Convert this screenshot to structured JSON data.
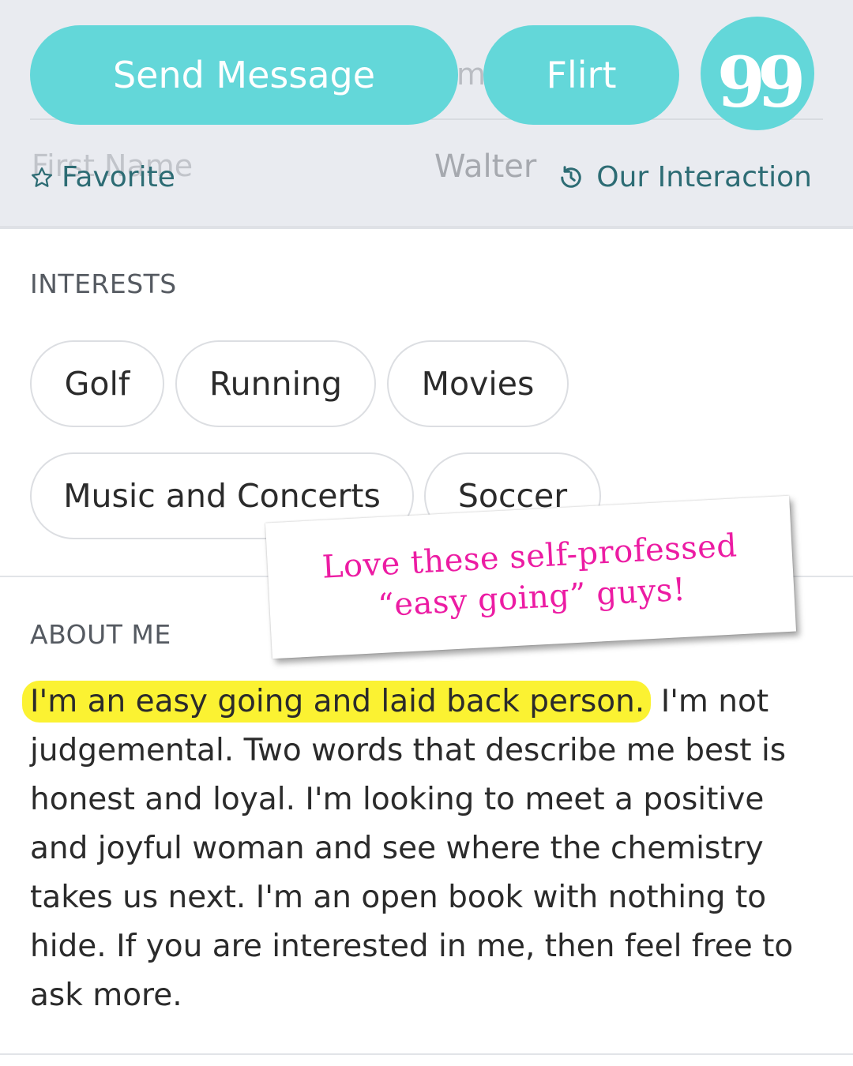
{
  "header": {
    "send_message_label": "Send Message",
    "flirt_label": "Flirt",
    "quote_glyph": "99",
    "ghost_text": "m",
    "first_name_label": "First Name",
    "first_name_value": "Walter",
    "favorite_label": "Favorite",
    "interaction_label": "Our Interaction"
  },
  "interests": {
    "title": "INTERESTS",
    "items": [
      "Golf",
      "Running",
      "Movies",
      "Music and Concerts",
      "Soccer"
    ]
  },
  "about": {
    "title": "ABOUT ME",
    "highlighted": "I'm an easy going and laid back person.",
    "rest": " I'm not judgemental. Two words that describe me best is honest and loyal. I'm looking to meet a positive and joyful woman and see where the chemistry takes us next. I'm an open book with nothing to hide. If you are interested in me, then feel free to ask more."
  },
  "annotation": {
    "line1": "Love these self-professed",
    "line2": "“easy going” guys!"
  },
  "colors": {
    "accent": "#63d7d9",
    "link": "#2d6c74",
    "highlight": "#fbf232",
    "annotation": "#ec1ca3",
    "header_bg": "#e9ebf0"
  },
  "icons": {
    "favorite": "star-outline-icon",
    "interaction": "history-clock-icon",
    "quote": "quote-icon"
  }
}
